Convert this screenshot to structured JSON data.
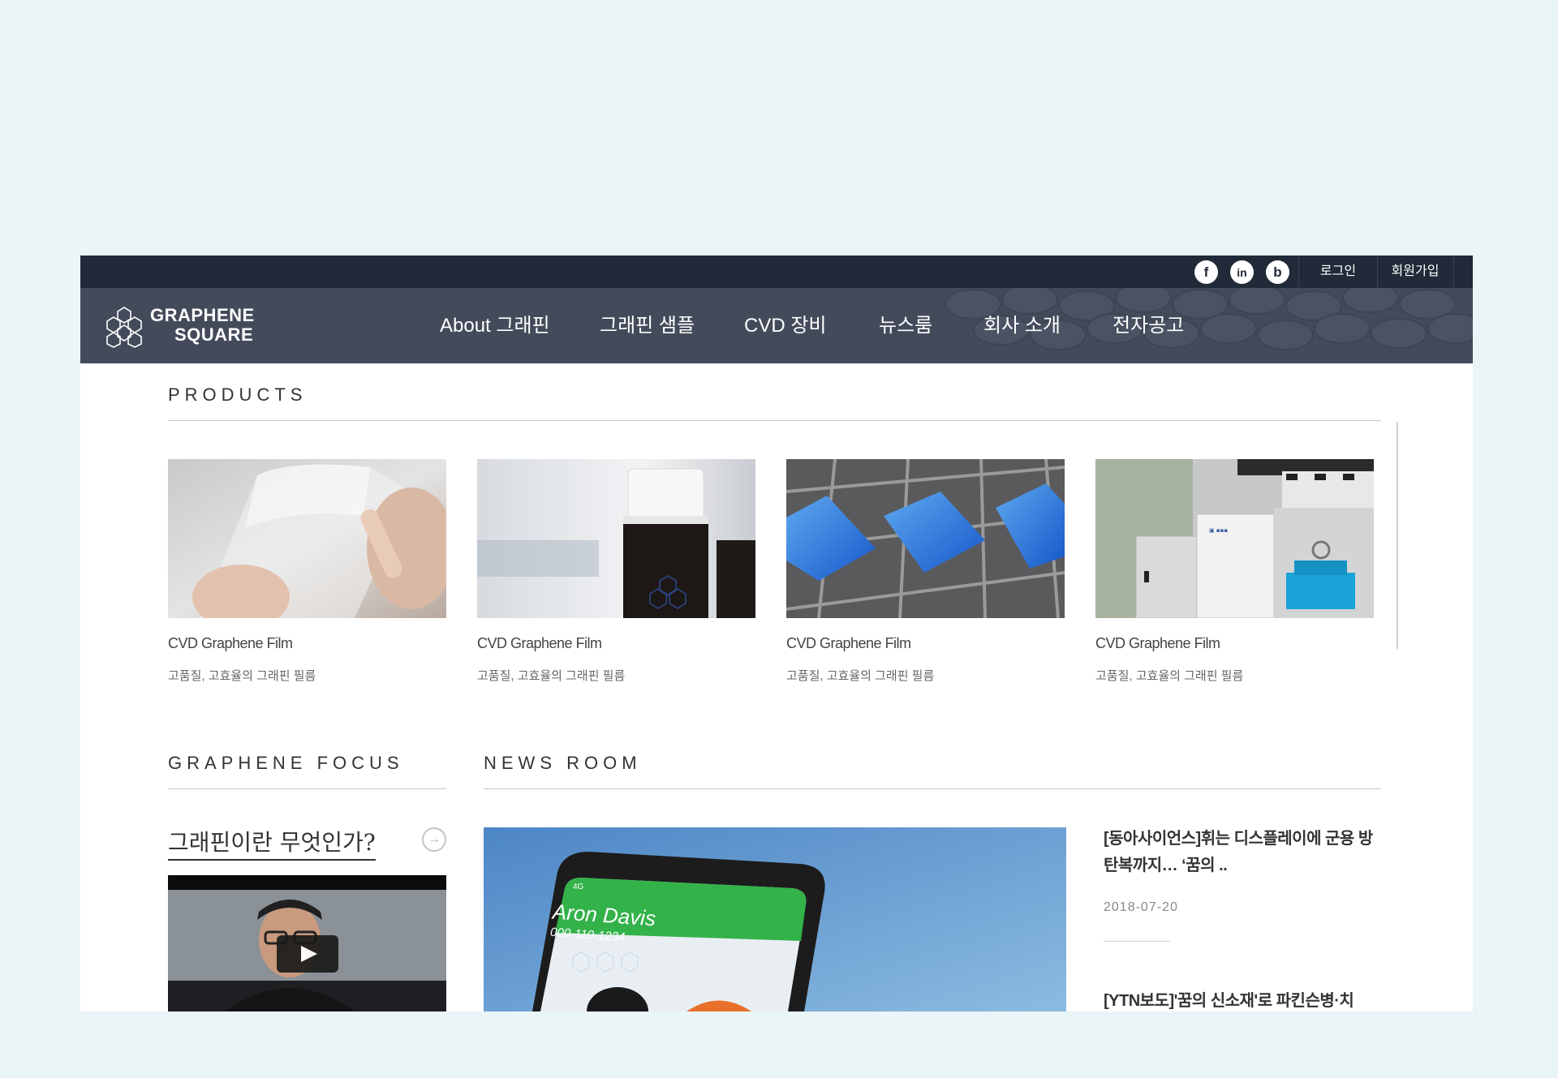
{
  "header": {
    "social": [
      {
        "icon": "facebook-icon",
        "glyph": "f"
      },
      {
        "icon": "linkedin-icon",
        "glyph": "in"
      },
      {
        "icon": "blog-icon",
        "glyph": "b"
      }
    ],
    "login_label": "로그인",
    "signup_label": "회원가입",
    "logo": {
      "line1": "GRAPHENE",
      "line2": "SQUARE"
    },
    "nav": [
      "About 그래핀",
      "그래핀 샘플",
      "CVD 장비",
      "뉴스룸",
      "회사 소개",
      "전자공고"
    ]
  },
  "products": {
    "title": "PRODUCTS",
    "items": [
      {
        "title": "CVD Graphene Film",
        "subtitle": "고품질, 고효율의 그래핀 필름"
      },
      {
        "title": "CVD Graphene Film",
        "subtitle": "고품질, 고효율의 그래핀 필름"
      },
      {
        "title": "CVD Graphene Film",
        "subtitle": "고품질, 고효율의 그래핀 필름"
      },
      {
        "title": "CVD Graphene Film",
        "subtitle": "고품질, 고효율의 그래핀 필름"
      }
    ]
  },
  "focus": {
    "title": "GRAPHENE FOCUS",
    "heading": "그래핀이란 무엇인가?"
  },
  "newsroom": {
    "title": "NEWS ROOM",
    "image_overlay": {
      "name": "Aron Davis",
      "number": "000-110-1234",
      "signal": "4G"
    },
    "items": [
      {
        "title": "[동아사이언스]휘는 디스플레이에 군용 방탄복까지… ‘꿈의 ..",
        "date": "2018-07-20"
      },
      {
        "title": "[YTN보도]'꿈의 신소재'로 파킨슨병·치"
      }
    ]
  },
  "colors": {
    "page_bg": "#eaf5f8",
    "utilbar": "#212a38",
    "navbar": "#434b5b",
    "accent_blue": "#1f6fd6"
  }
}
